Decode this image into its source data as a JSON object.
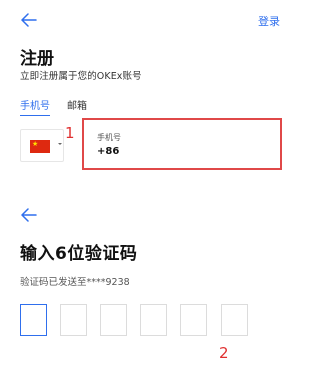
{
  "header": {
    "login_label": "登录"
  },
  "register": {
    "title": "注册",
    "subtitle": "立即注册属于您的OKEx账号",
    "tabs": [
      {
        "label": "手机号",
        "active": true
      },
      {
        "label": "邮箱",
        "active": false
      }
    ],
    "country_flag": "china-flag-icon",
    "phone_field": {
      "label": "手机号",
      "country_code": "+86"
    },
    "annotation_1": "1"
  },
  "verify": {
    "title": "输入6位验证码",
    "sent_text": "验证码已发送至****9238",
    "code_digits": [
      "",
      "",
      "",
      "",
      "",
      ""
    ],
    "annotation_2": "2"
  },
  "colors": {
    "accent": "#2f6fed",
    "annotation": "#e03030",
    "highlight_border": "#e04848"
  }
}
